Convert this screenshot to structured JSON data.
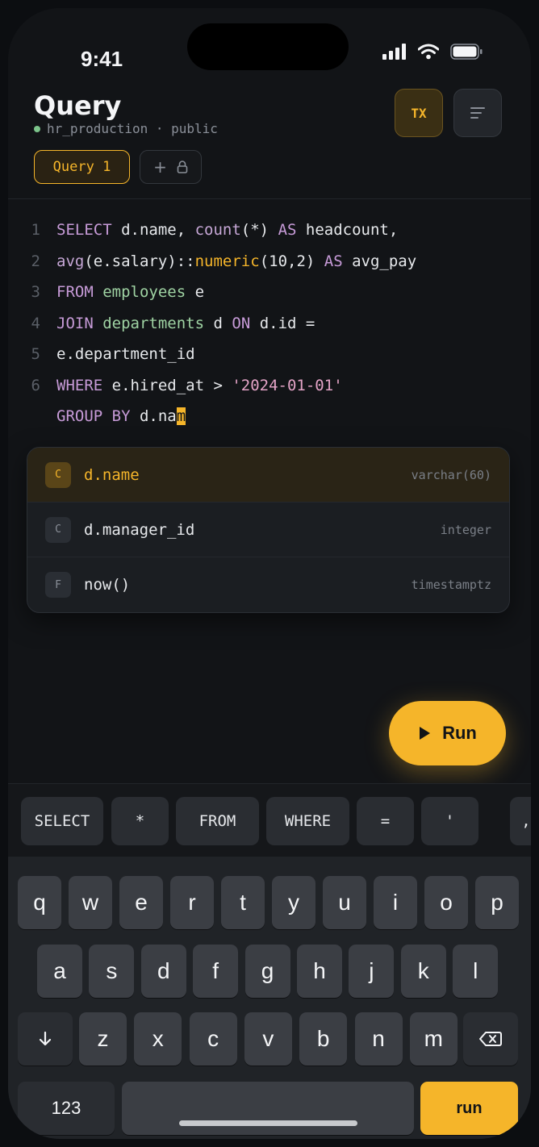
{
  "status": {
    "time": "9:41"
  },
  "header": {
    "title": "Query",
    "subtitle": "hr_production · public",
    "tx_label": "TX"
  },
  "tabs": {
    "active": "Query 1",
    "add": "+"
  },
  "editor": {
    "line_numbers": [
      "1",
      "2",
      "3",
      "4",
      "5",
      "6"
    ],
    "lines": [
      [
        {
          "t": "SELECT",
          "c": "kw"
        },
        {
          "t": " d.name, ",
          "c": "code"
        },
        {
          "t": "count",
          "c": "fn"
        },
        {
          "t": "(*) ",
          "c": "code"
        },
        {
          "t": "AS",
          "c": "kw"
        },
        {
          "t": " headcount,",
          "c": "code"
        }
      ],
      [
        {
          "t": "avg",
          "c": "fn"
        },
        {
          "t": "(e.salary)::",
          "c": "code"
        },
        {
          "t": "numeric",
          "c": "type"
        },
        {
          "t": "(10,2) ",
          "c": "code"
        },
        {
          "t": "AS",
          "c": "kw"
        },
        {
          "t": " avg_pay",
          "c": "code"
        }
      ],
      [
        {
          "t": "FROM",
          "c": "kw"
        },
        {
          "t": " ",
          "c": "code"
        },
        {
          "t": "employees",
          "c": "tbl"
        },
        {
          "t": " e",
          "c": "code"
        }
      ],
      [
        {
          "t": "JOIN",
          "c": "kw"
        },
        {
          "t": " ",
          "c": "code"
        },
        {
          "t": "departments",
          "c": "tbl"
        },
        {
          "t": " d ",
          "c": "code"
        },
        {
          "t": "ON",
          "c": "kw"
        },
        {
          "t": " d.id =",
          "c": "code"
        }
      ],
      [
        {
          "t": "e.department_id",
          "c": "code"
        }
      ],
      [
        {
          "t": "WHERE",
          "c": "kw"
        },
        {
          "t": " e.hired_at > ",
          "c": "code"
        },
        {
          "t": "'2024-01-01'",
          "c": "str"
        }
      ],
      [
        {
          "t": "GROUP BY",
          "c": "kw"
        },
        {
          "t": " d.na",
          "c": "code"
        },
        {
          "t": "m",
          "c": "cursor"
        }
      ]
    ]
  },
  "autocomplete": [
    {
      "badge": "C",
      "name": "d.name",
      "type": "varchar(60)",
      "selected": true
    },
    {
      "badge": "C",
      "name": "d.manager_id",
      "type": "integer",
      "selected": false
    },
    {
      "badge": "F",
      "name": "now()",
      "type": "timestamptz",
      "selected": false
    }
  ],
  "run_button": {
    "label": "Run"
  },
  "suggestions": [
    "SELECT",
    "*",
    "FROM",
    "WHERE",
    "=",
    "'",
    ","
  ],
  "keyboard": {
    "row1": [
      "q",
      "w",
      "e",
      "r",
      "t",
      "y",
      "u",
      "i",
      "o",
      "p"
    ],
    "row2": [
      "a",
      "s",
      "d",
      "f",
      "g",
      "h",
      "j",
      "k",
      "l"
    ],
    "row3": [
      "z",
      "x",
      "c",
      "v",
      "b",
      "n",
      "m"
    ],
    "numbers_key": "123",
    "return_key": "run"
  },
  "colors": {
    "accent": "#f5b52a",
    "background": "#121417"
  }
}
